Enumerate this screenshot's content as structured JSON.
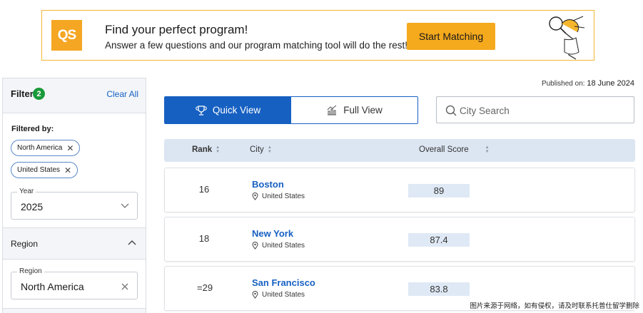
{
  "banner": {
    "logo_text": "QS",
    "title": "Find your perfect program!",
    "subtitle": "Answer a few questions and our program matching tool will do the rest!",
    "cta_label": "Start Matching",
    "accent_color": "#f5a91d"
  },
  "sidebar": {
    "filter_label": "Filter",
    "filter_count": "2",
    "clear_all_label": "Clear All",
    "filtered_by_label": "Filtered by:",
    "chips": [
      {
        "label": "North America"
      },
      {
        "label": "United States"
      }
    ],
    "year": {
      "legend": "Year",
      "value": "2025"
    },
    "region_header": "Region",
    "region_field": {
      "legend": "Region",
      "value": "North America"
    }
  },
  "main": {
    "published_prefix": "Published on:",
    "published_date": "18 June 2024",
    "views": {
      "quick": "Quick View",
      "full": "Full View"
    },
    "search_placeholder": "City Search",
    "columns": {
      "rank": "Rank",
      "city": "City",
      "score": "Overall Score"
    },
    "rows": [
      {
        "rank": "16",
        "city": "Boston",
        "country": "United States",
        "score": "89"
      },
      {
        "rank": "18",
        "city": "New York",
        "country": "United States",
        "score": "87.4"
      },
      {
        "rank": "=29",
        "city": "San Francisco",
        "country": "United States",
        "score": "83.8"
      }
    ]
  },
  "watermark": "图片来源于网络，如有侵权，请及时联系托普仕留学删除",
  "colors": {
    "primary_blue": "#1660c2",
    "badge_green": "#1a9a3a",
    "header_bg": "#dce6f2"
  }
}
